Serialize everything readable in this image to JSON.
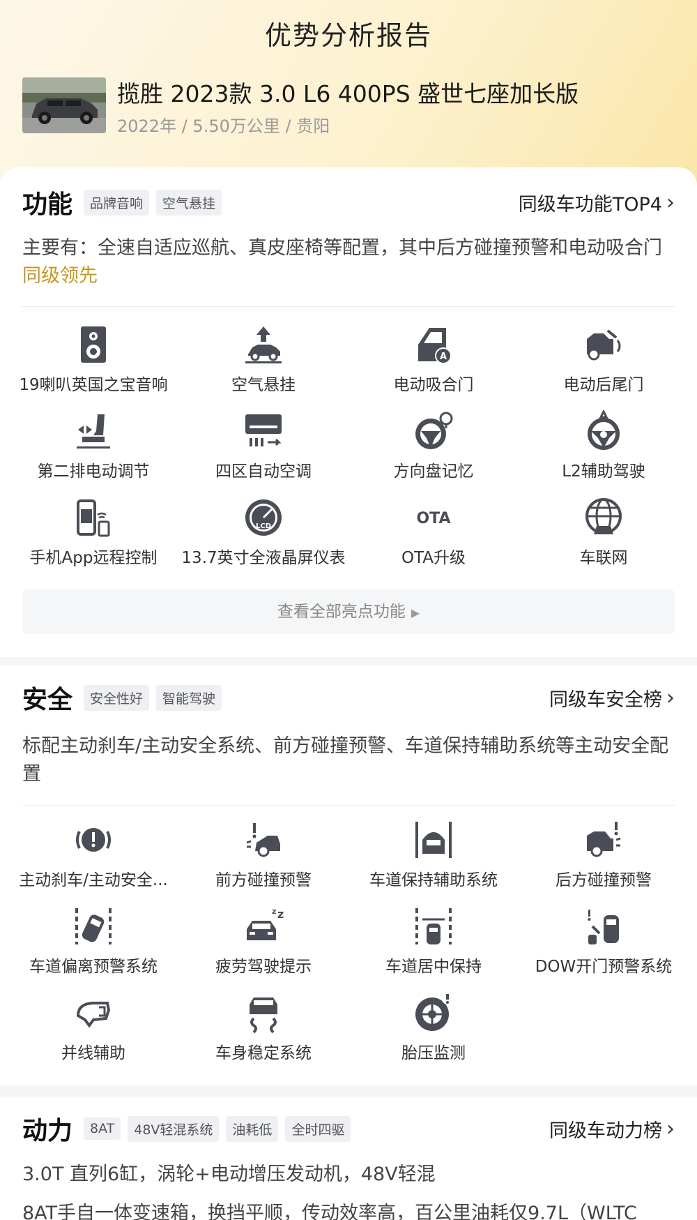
{
  "header": {
    "title": "优势分析报告",
    "car_name": "揽胜 2023款 3.0 L6 400PS 盛世七座加长版",
    "car_meta": "2022年 / 5.50万公里 / 贵阳"
  },
  "function": {
    "title": "功能",
    "tags": [
      "品牌音响",
      "空气悬挂"
    ],
    "link": "同级车功能TOP4",
    "desc_main": "主要有：全速自适应巡航、真皮座椅等配置，其中后方碰撞预警和电动吸合门",
    "desc_highlight": "同级领先",
    "items": [
      {
        "label": "19喇叭英国之宝音响",
        "icon": "speaker-icon"
      },
      {
        "label": "空气悬挂",
        "icon": "air-suspension-icon"
      },
      {
        "label": "电动吸合门",
        "icon": "soft-close-door-icon"
      },
      {
        "label": "电动后尾门",
        "icon": "power-tailgate-icon"
      },
      {
        "label": "第二排电动调节",
        "icon": "seat-adjust-icon"
      },
      {
        "label": "四区自动空调",
        "icon": "air-conditioner-icon"
      },
      {
        "label": "方向盘记忆",
        "icon": "steering-memory-icon"
      },
      {
        "label": "L2辅助驾驶",
        "icon": "assist-driving-icon"
      },
      {
        "label": "手机App远程控制",
        "icon": "phone-remote-icon"
      },
      {
        "label": "13.7英寸全液晶屏仪表",
        "icon": "lcd-gauge-icon"
      },
      {
        "label": "OTA升级",
        "icon": "ota-icon"
      },
      {
        "label": "车联网",
        "icon": "connected-car-icon"
      }
    ],
    "view_all": "查看全部亮点功能"
  },
  "safety": {
    "title": "安全",
    "tags": [
      "安全性好",
      "智能驾驶"
    ],
    "link": "同级车安全榜",
    "desc": "标配主动刹车/主动安全系统、前方碰撞预警、车道保持辅助系统等主动安全配置",
    "items": [
      {
        "label": "主动刹车/主动安全...",
        "icon": "brake-warning-icon"
      },
      {
        "label": "前方碰撞预警",
        "icon": "front-collision-icon"
      },
      {
        "label": "车道保持辅助系统",
        "icon": "lane-keep-icon"
      },
      {
        "label": "后方碰撞预警",
        "icon": "rear-collision-icon"
      },
      {
        "label": "车道偏离预警系统",
        "icon": "lane-departure-icon"
      },
      {
        "label": "疲劳驾驶提示",
        "icon": "fatigue-icon"
      },
      {
        "label": "车道居中保持",
        "icon": "lane-center-icon"
      },
      {
        "label": "DOW开门预警系统",
        "icon": "door-open-warning-icon"
      },
      {
        "label": "并线辅助",
        "icon": "blind-spot-icon"
      },
      {
        "label": "车身稳定系统",
        "icon": "stability-icon"
      },
      {
        "label": "胎压监测",
        "icon": "tire-pressure-icon"
      }
    ]
  },
  "power": {
    "title": "动力",
    "tags": [
      "8AT",
      "48V轻混系统",
      "油耗低",
      "全时四驱"
    ],
    "link": "同级车动力榜",
    "desc_line1": "3.0T 直列6缸，涡轮+电动增压发动机，48V轻混",
    "desc_line2": "8AT手自一体变速箱，换挡平顺，传动效率高，百公里油耗仅9.7L（WLTC"
  },
  "colors": {
    "accent": "#c8961e",
    "icon": "#4a4d55",
    "tag_bg": "#eef0f4"
  }
}
